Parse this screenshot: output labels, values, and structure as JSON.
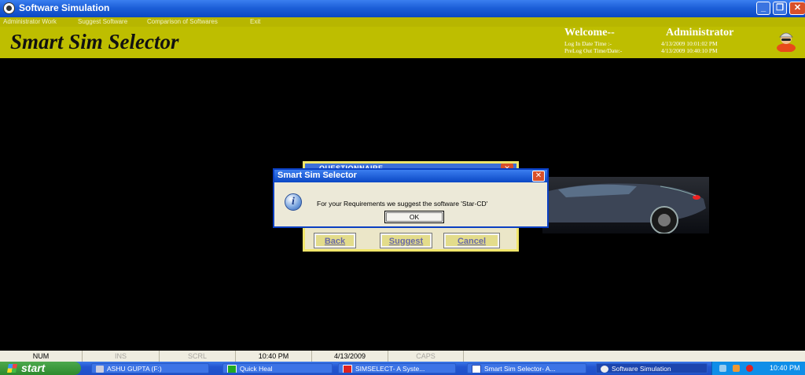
{
  "window": {
    "title": "Software Simulation"
  },
  "menu": [
    "Administrator Work",
    "Suggest Software",
    "Comparison of Softwares",
    "Exit"
  ],
  "header": {
    "brand": "Smart Sim Selector",
    "welcome_label": "Welcome--",
    "user": "Administrator",
    "login_label": "Log In Date Time :-",
    "login_value": "4/13/2009 10:01:02 PM",
    "prelogout_label": "PreLog Out Time/Date:-",
    "prelogout_value": "4/13/2009 10:40:10 PM"
  },
  "questionnaire": {
    "title": "QUESTIONNAIRE",
    "buttons": {
      "back": "Back",
      "suggest": "Suggest",
      "cancel": "Cancel"
    }
  },
  "message_box": {
    "title": "Smart Sim Selector",
    "text": "For your Requirements we suggest the software 'Star-CD'",
    "ok": "OK"
  },
  "status_bar": {
    "num": "NUM",
    "ins": "INS",
    "scrl": "SCRL",
    "time": "10:40 PM",
    "date": "4/13/2009",
    "caps": "CAPS"
  },
  "taskbar": {
    "start": "start",
    "tasks": [
      {
        "label": "ASHU GUPTA (F:)"
      },
      {
        "label": "Quick Heal"
      },
      {
        "label": "SIMSELECT- A Syste..."
      },
      {
        "label": "Smart Sim Selector- A..."
      },
      {
        "label": "Software Simulation"
      }
    ],
    "clock": "10:40 PM"
  },
  "colors": {
    "banner": "#bebe00",
    "menubar": "#b7b600",
    "titlebar": "#1d5fd8"
  }
}
